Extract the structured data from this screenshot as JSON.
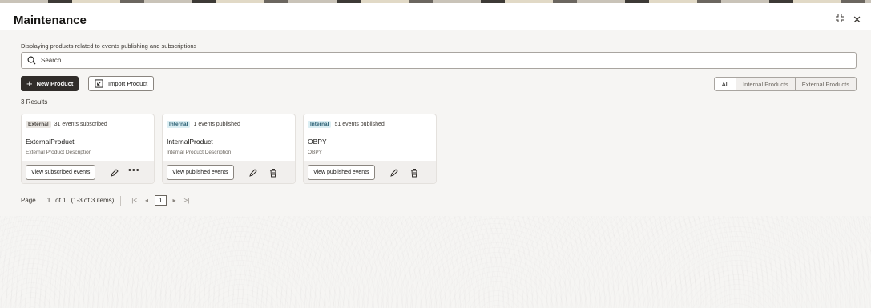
{
  "header": {
    "title": "Maintenance",
    "icons": [
      "collapse-icon",
      "close-icon"
    ]
  },
  "main": {
    "subtitle": "Displaying products related to events publishing and subscriptions",
    "search_placeholder": "Search",
    "new_product_label": "New Product",
    "import_product_label": "Import Product",
    "filters": [
      "All",
      "Internal Products",
      "External Products"
    ],
    "selected_filter": "All",
    "results": "3 Results"
  },
  "cards": [
    {
      "badge": "External",
      "events": "31 events subscribed",
      "name": "ExternalProduct",
      "description": "External Product Description",
      "button": "View subscribed events",
      "actions": [
        "edit-icon",
        "more-icon"
      ]
    },
    {
      "badge": "Internal",
      "events": "1 events published",
      "name": "InternalProduct",
      "description": "Internal Product Description",
      "button": "View published events",
      "actions": [
        "edit-icon",
        "delete-icon"
      ]
    },
    {
      "badge": "Internal",
      "events": "51 events published",
      "name": "OBPY",
      "description": "OBPY",
      "button": "View published events",
      "actions": [
        "edit-icon",
        "delete-icon"
      ]
    }
  ],
  "pagination": {
    "page_label": "Page",
    "page": "1",
    "of": "of 1",
    "items": "(1-3 of 3 items)",
    "current": "1"
  },
  "colors": {
    "primary_button": "#312d2a",
    "internal_badge": "#dbeef3",
    "external_badge": "#e9e6e2"
  }
}
